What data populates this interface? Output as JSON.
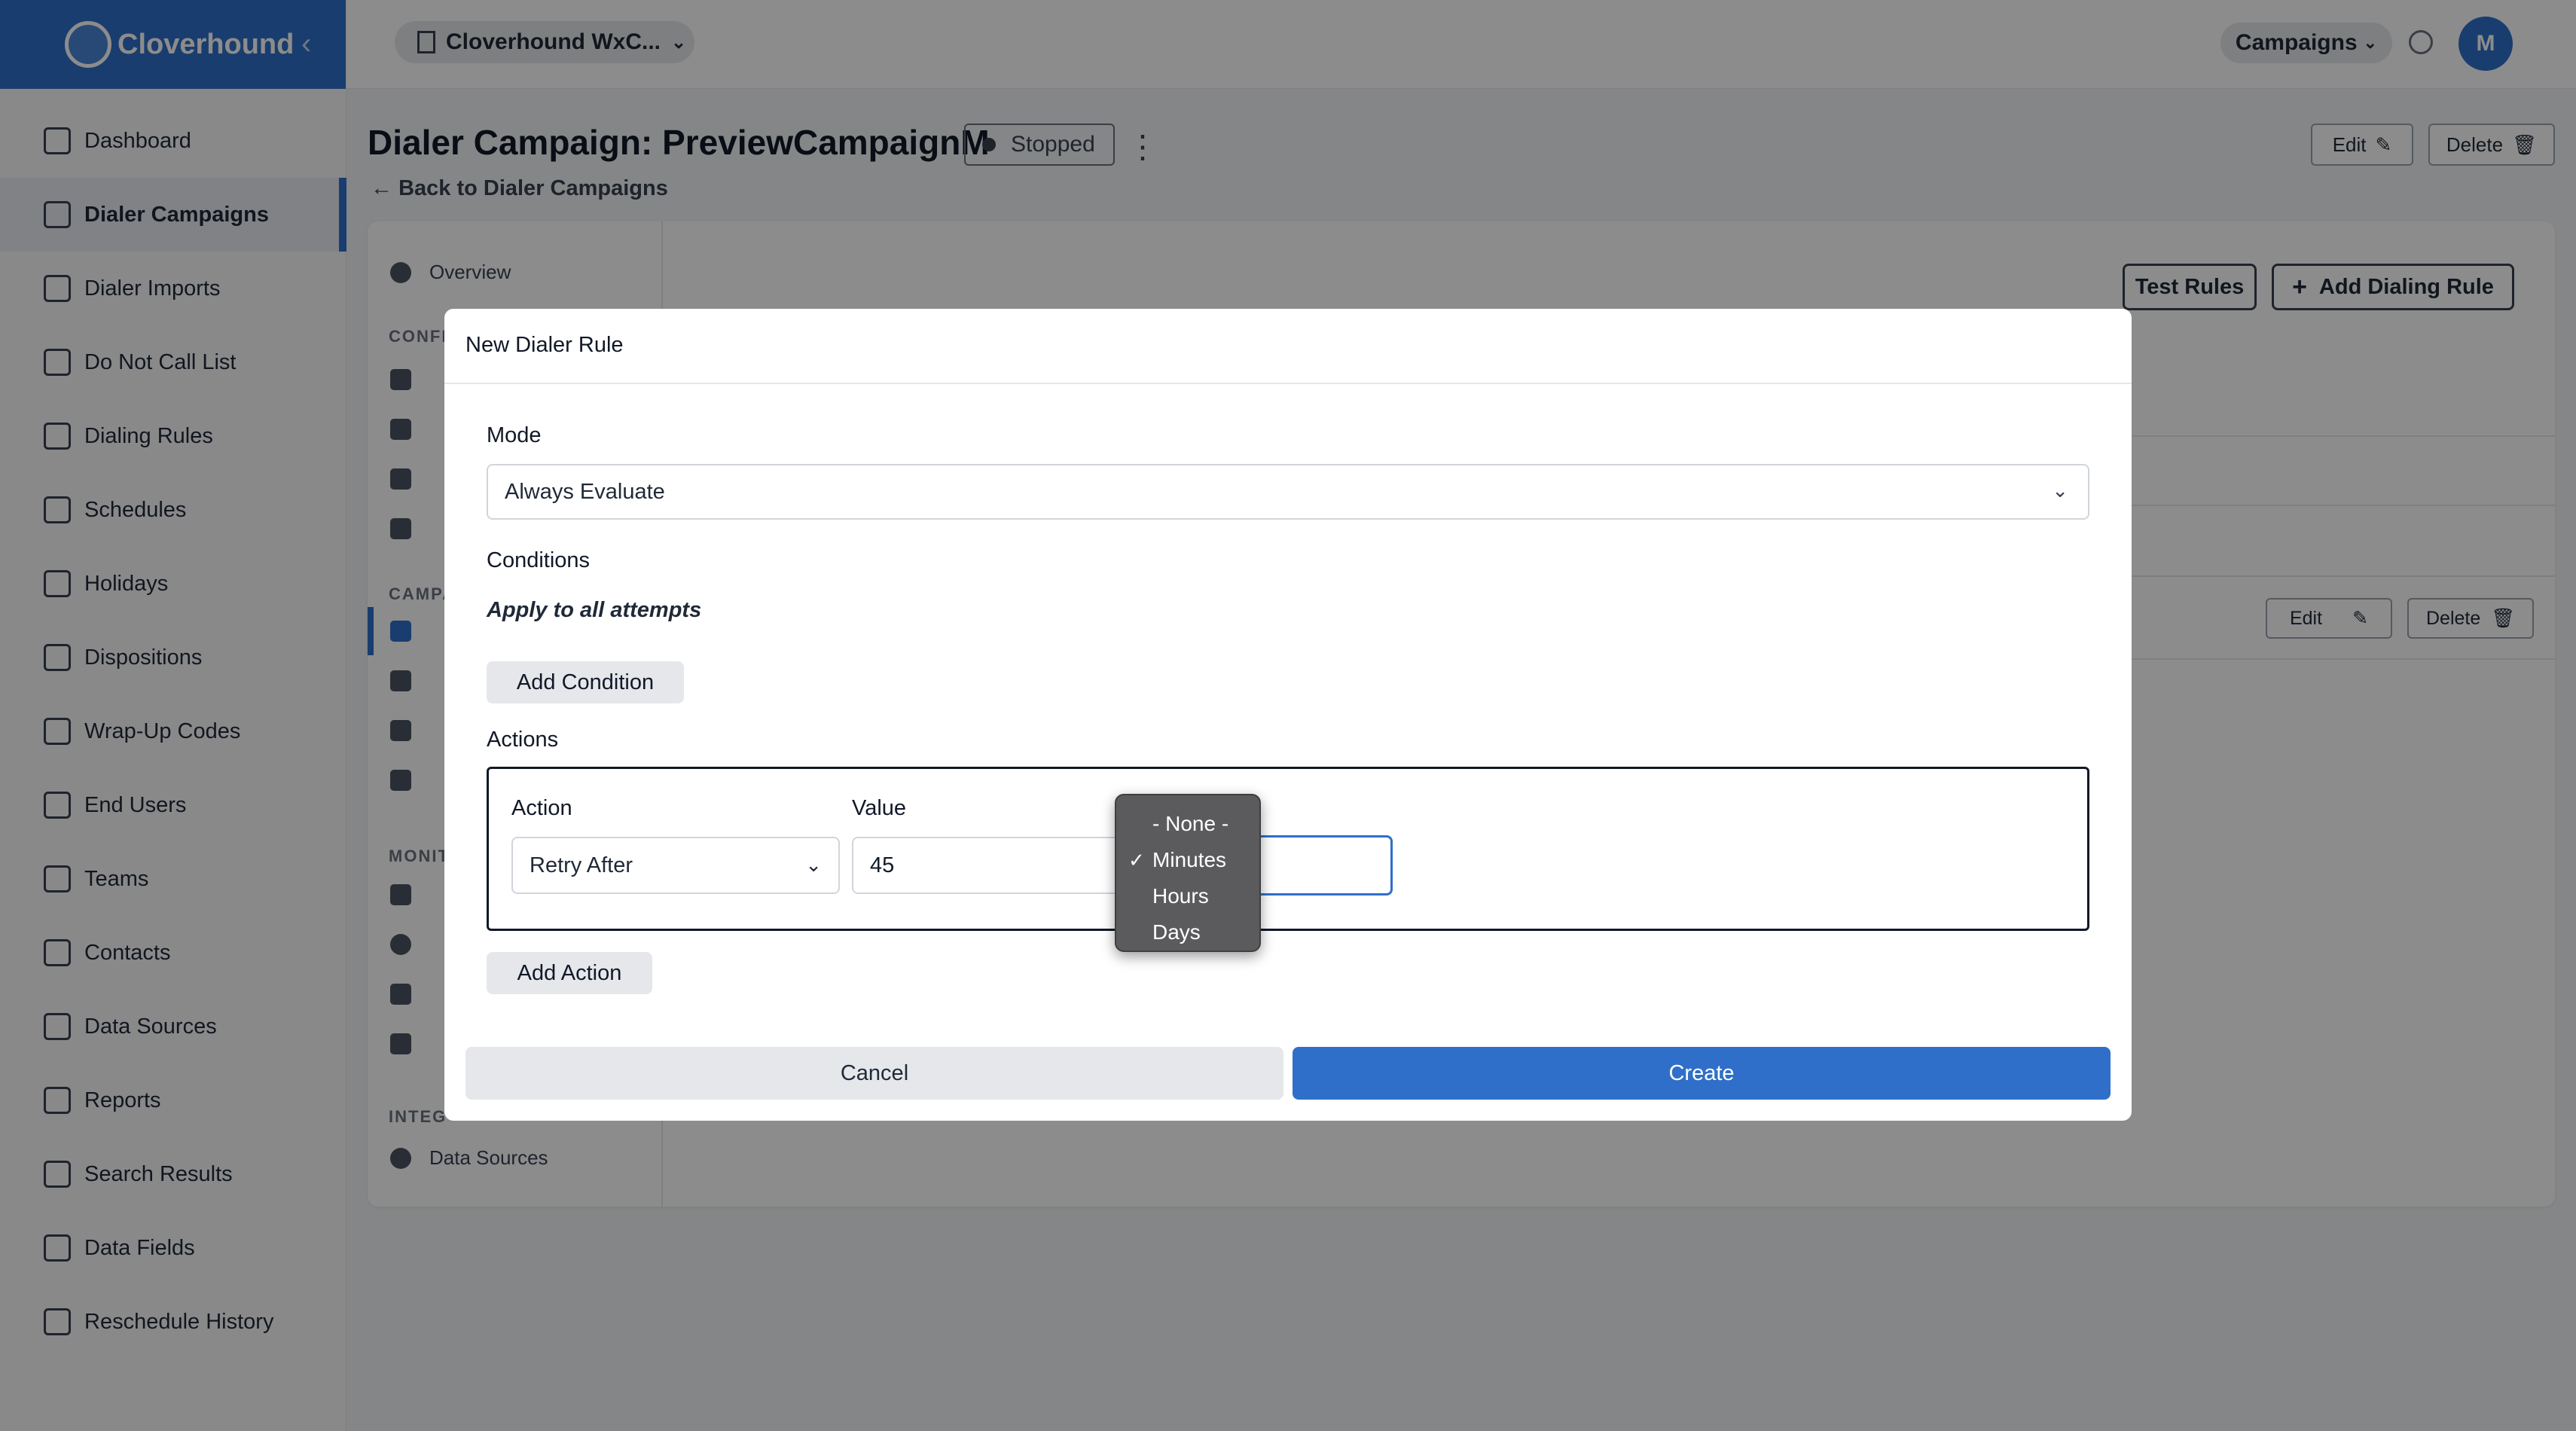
{
  "brand": {
    "name": "Cloverhound"
  },
  "sidebar": {
    "items": [
      {
        "label": "Dashboard"
      },
      {
        "label": "Dialer Campaigns"
      },
      {
        "label": "Dialer Imports"
      },
      {
        "label": "Do Not Call List"
      },
      {
        "label": "Dialing Rules"
      },
      {
        "label": "Schedules"
      },
      {
        "label": "Holidays"
      },
      {
        "label": "Dispositions"
      },
      {
        "label": "Wrap-Up Codes"
      },
      {
        "label": "End Users"
      },
      {
        "label": "Teams"
      },
      {
        "label": "Contacts"
      },
      {
        "label": "Data Sources"
      },
      {
        "label": "Reports"
      },
      {
        "label": "Search Results"
      },
      {
        "label": "Data Fields"
      },
      {
        "label": "Reschedule History"
      }
    ],
    "active_index": 1
  },
  "topbar": {
    "org": "Cloverhound WxC...",
    "campaigns": "Campaigns",
    "avatar_initial": "M"
  },
  "page": {
    "title": "Dialer Campaign: PreviewCampaignM",
    "status": "Stopped",
    "back_link": "Back to Dialer Campaigns",
    "edit": "Edit",
    "delete": "Delete"
  },
  "subnav": {
    "overview": "Overview",
    "section_config": "CONFI",
    "section_campaign": "CAMPA",
    "section_monitor": "MONIT",
    "section_integrations": "INTEG",
    "data_sources": "Data Sources"
  },
  "rules_panel": {
    "test_rules": "Test Rules",
    "add_rule": "Add Dialing Rule",
    "row_edit": "Edit",
    "row_delete": "Delete"
  },
  "modal": {
    "title": "New Dialer Rule",
    "mode_label": "Mode",
    "mode_value": "Always Evaluate",
    "conditions_label": "Conditions",
    "apply_text": "Apply to all attempts",
    "add_condition": "Add Condition",
    "actions_label": "Actions",
    "action_label": "Action",
    "value_label": "Value",
    "action_value": "Retry After",
    "value_value": "45",
    "add_action": "Add Action",
    "cancel": "Cancel",
    "create": "Create"
  },
  "unit_dropdown": {
    "options": [
      "- None -",
      "Minutes",
      "Hours",
      "Days"
    ],
    "selected": "Minutes"
  },
  "colors": {
    "accent": "#2f6fc9"
  }
}
